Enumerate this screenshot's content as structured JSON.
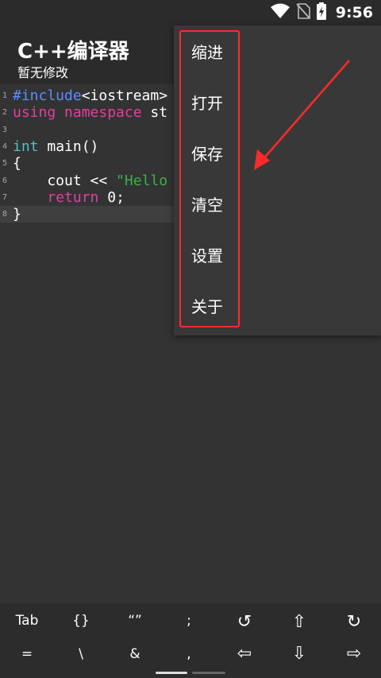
{
  "status_bar": {
    "time": "9:56",
    "icons": [
      "wifi-icon",
      "no-sim-icon",
      "battery-charging-icon"
    ]
  },
  "app": {
    "title": "C++编译器",
    "subtitle": "暂无修改"
  },
  "editor": {
    "lines": [
      {
        "num": "1",
        "tokens": [
          {
            "t": "#include",
            "c": "blue"
          },
          {
            "t": "<iostream>",
            "c": "plain"
          }
        ]
      },
      {
        "num": "2",
        "tokens": [
          {
            "t": "using namespace",
            "c": "pink"
          },
          {
            "t": " st",
            "c": "plain"
          }
        ]
      },
      {
        "num": "3",
        "tokens": []
      },
      {
        "num": "4",
        "tokens": [
          {
            "t": "int",
            "c": "cyan"
          },
          {
            "t": " main()",
            "c": "plain"
          }
        ]
      },
      {
        "num": "5",
        "tokens": [
          {
            "t": "{",
            "c": "plain"
          }
        ]
      },
      {
        "num": "6",
        "tokens": [
          {
            "t": "    cout << ",
            "c": "plain"
          },
          {
            "t": "\"Hello",
            "c": "green"
          }
        ]
      },
      {
        "num": "7",
        "tokens": [
          {
            "t": "    ",
            "c": "plain"
          },
          {
            "t": "return",
            "c": "pink"
          },
          {
            "t": " 0;",
            "c": "plain"
          }
        ]
      },
      {
        "num": "8",
        "tokens": [
          {
            "t": "}",
            "c": "plain"
          }
        ]
      }
    ],
    "active_line": "8"
  },
  "menu": {
    "items": [
      "缩进",
      "打开",
      "保存",
      "清空",
      "设置",
      "关于"
    ]
  },
  "keyboard": {
    "row1": [
      "Tab",
      "{}",
      "“”",
      ";",
      "↺",
      "⇧",
      "↻"
    ],
    "row2": [
      "=",
      "\\",
      "&",
      ",",
      "⇦",
      "⇩",
      "⇨"
    ]
  },
  "colors": {
    "highlight": "#ff2a2a",
    "keyword_blue": "#5a8cff",
    "keyword_pink": "#e0409f",
    "type_cyan": "#4fc1c9",
    "string_green": "#38b24a"
  }
}
